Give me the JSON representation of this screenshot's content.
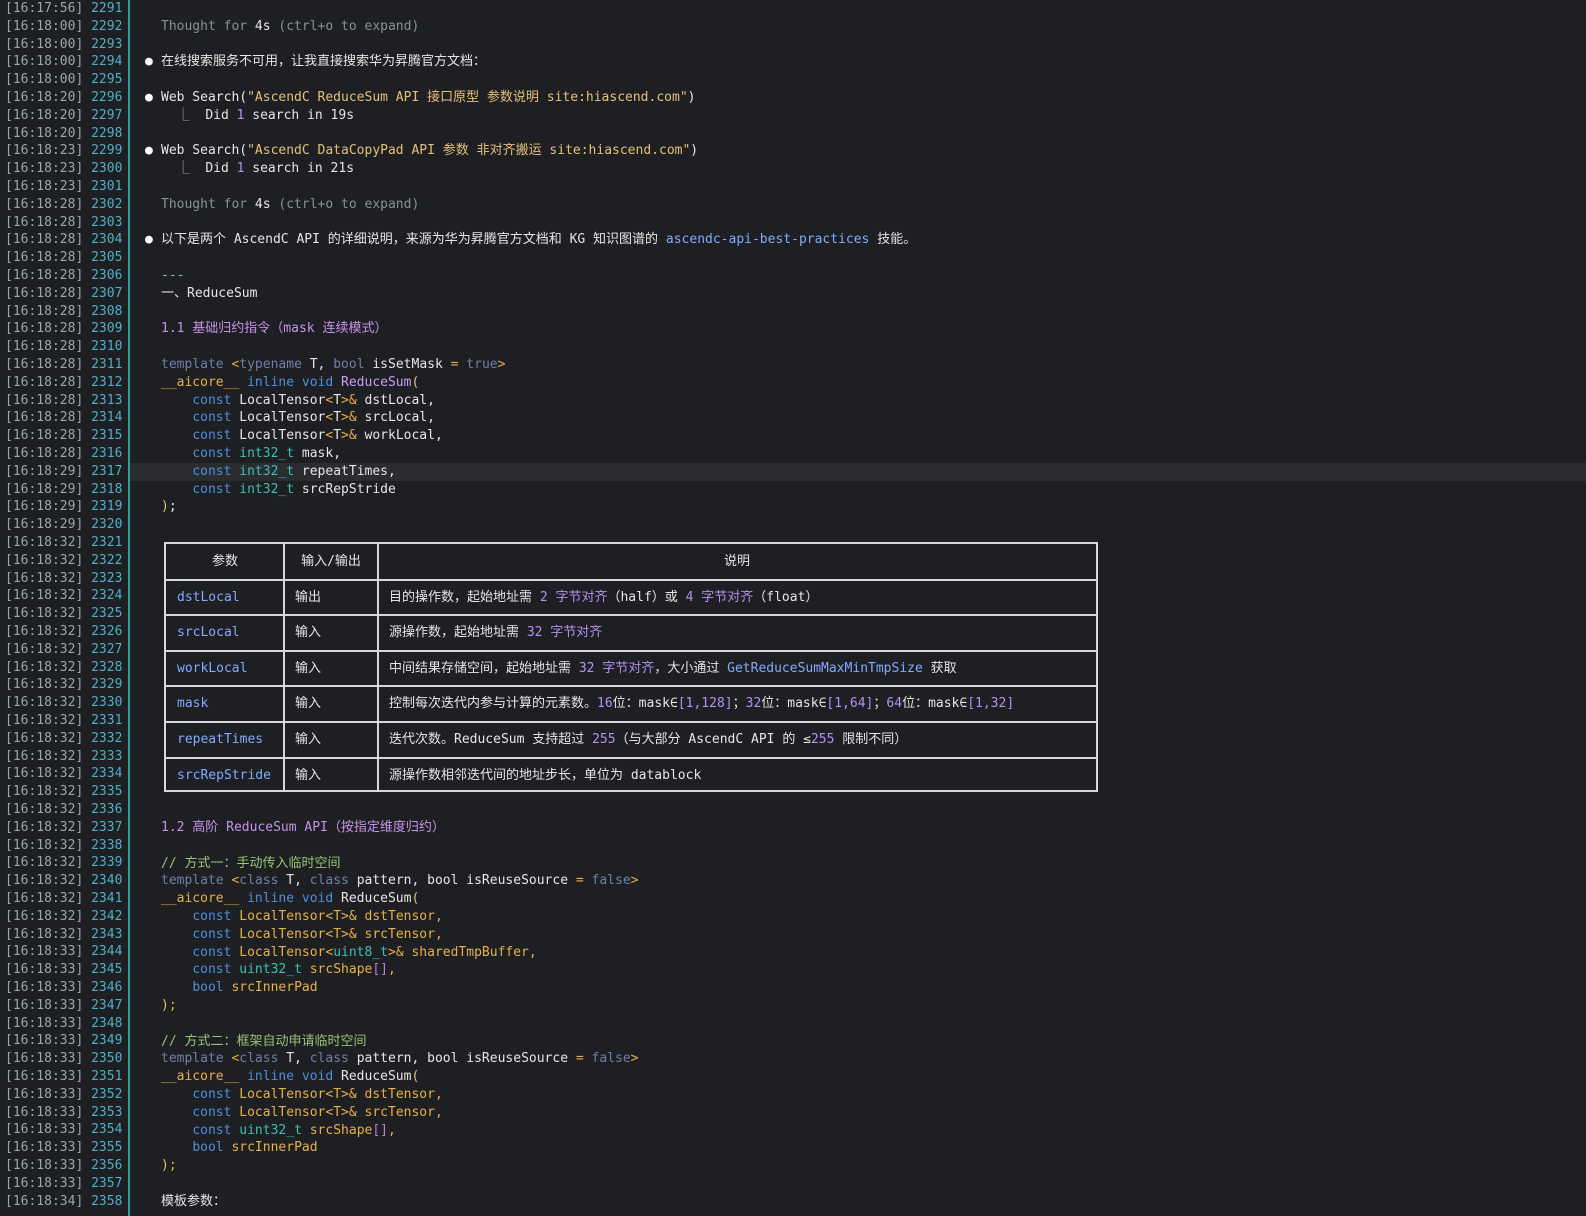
{
  "gutter": [
    {
      "ts": "[16:17:56]",
      "n": "2291"
    },
    {
      "ts": "[16:18:00]",
      "n": "2292"
    },
    {
      "ts": "[16:18:00]",
      "n": "2293"
    },
    {
      "ts": "[16:18:00]",
      "n": "2294"
    },
    {
      "ts": "[16:18:00]",
      "n": "2295"
    },
    {
      "ts": "[16:18:20]",
      "n": "2296"
    },
    {
      "ts": "[16:18:20]",
      "n": "2297"
    },
    {
      "ts": "[16:18:20]",
      "n": "2298"
    },
    {
      "ts": "[16:18:23]",
      "n": "2299"
    },
    {
      "ts": "[16:18:23]",
      "n": "2300"
    },
    {
      "ts": "[16:18:23]",
      "n": "2301"
    },
    {
      "ts": "[16:18:28]",
      "n": "2302"
    },
    {
      "ts": "[16:18:28]",
      "n": "2303"
    },
    {
      "ts": "[16:18:28]",
      "n": "2304"
    },
    {
      "ts": "[16:18:28]",
      "n": "2305"
    },
    {
      "ts": "[16:18:28]",
      "n": "2306"
    },
    {
      "ts": "[16:18:28]",
      "n": "2307"
    },
    {
      "ts": "[16:18:28]",
      "n": "2308"
    },
    {
      "ts": "[16:18:28]",
      "n": "2309"
    },
    {
      "ts": "[16:18:28]",
      "n": "2310"
    },
    {
      "ts": "[16:18:28]",
      "n": "2311"
    },
    {
      "ts": "[16:18:28]",
      "n": "2312"
    },
    {
      "ts": "[16:18:28]",
      "n": "2313"
    },
    {
      "ts": "[16:18:28]",
      "n": "2314"
    },
    {
      "ts": "[16:18:28]",
      "n": "2315"
    },
    {
      "ts": "[16:18:28]",
      "n": "2316"
    },
    {
      "ts": "[16:18:29]",
      "n": "2317"
    },
    {
      "ts": "[16:18:29]",
      "n": "2318"
    },
    {
      "ts": "[16:18:29]",
      "n": "2319"
    },
    {
      "ts": "[16:18:29]",
      "n": "2320"
    },
    {
      "ts": "[16:18:32]",
      "n": "2321"
    },
    {
      "ts": "[16:18:32]",
      "n": "2322"
    },
    {
      "ts": "[16:18:32]",
      "n": "2323"
    },
    {
      "ts": "[16:18:32]",
      "n": "2324"
    },
    {
      "ts": "[16:18:32]",
      "n": "2325"
    },
    {
      "ts": "[16:18:32]",
      "n": "2326"
    },
    {
      "ts": "[16:18:32]",
      "n": "2327"
    },
    {
      "ts": "[16:18:32]",
      "n": "2328"
    },
    {
      "ts": "[16:18:32]",
      "n": "2329"
    },
    {
      "ts": "[16:18:32]",
      "n": "2330"
    },
    {
      "ts": "[16:18:32]",
      "n": "2331"
    },
    {
      "ts": "[16:18:32]",
      "n": "2332"
    },
    {
      "ts": "[16:18:32]",
      "n": "2333"
    },
    {
      "ts": "[16:18:32]",
      "n": "2334"
    },
    {
      "ts": "[16:18:32]",
      "n": "2335"
    },
    {
      "ts": "[16:18:32]",
      "n": "2336"
    },
    {
      "ts": "[16:18:32]",
      "n": "2337"
    },
    {
      "ts": "[16:18:32]",
      "n": "2338"
    },
    {
      "ts": "[16:18:32]",
      "n": "2339"
    },
    {
      "ts": "[16:18:32]",
      "n": "2340"
    },
    {
      "ts": "[16:18:32]",
      "n": "2341"
    },
    {
      "ts": "[16:18:32]",
      "n": "2342"
    },
    {
      "ts": "[16:18:32]",
      "n": "2343"
    },
    {
      "ts": "[16:18:33]",
      "n": "2344"
    },
    {
      "ts": "[16:18:33]",
      "n": "2345"
    },
    {
      "ts": "[16:18:33]",
      "n": "2346"
    },
    {
      "ts": "[16:18:33]",
      "n": "2347"
    },
    {
      "ts": "[16:18:33]",
      "n": "2348"
    },
    {
      "ts": "[16:18:33]",
      "n": "2349"
    },
    {
      "ts": "[16:18:33]",
      "n": "2350"
    },
    {
      "ts": "[16:18:33]",
      "n": "2351"
    },
    {
      "ts": "[16:18:33]",
      "n": "2352"
    },
    {
      "ts": "[16:18:33]",
      "n": "2353"
    },
    {
      "ts": "[16:18:33]",
      "n": "2354"
    },
    {
      "ts": "[16:18:33]",
      "n": "2355"
    },
    {
      "ts": "[16:18:33]",
      "n": "2356"
    },
    {
      "ts": "[16:18:33]",
      "n": "2357"
    },
    {
      "ts": "[16:18:34]",
      "n": "2358"
    }
  ],
  "lines": [
    {
      "idx": 1,
      "parts": [
        [
          "dim",
          "Thought for "
        ],
        [
          "white",
          "4s"
        ],
        [
          "dim",
          " ("
        ],
        [
          "dim",
          "ctrl+o to expand"
        ],
        [
          "dim",
          ")"
        ]
      ]
    },
    {
      "idx": 3,
      "bullet": "●",
      "parts": [
        [
          "white",
          "在线搜索服务不可用，让我直接搜索华为昇腾官方文档："
        ]
      ]
    },
    {
      "idx": 5,
      "bullet": "●",
      "parts": [
        [
          "white",
          "Web Search("
        ],
        [
          "str",
          "\"AscendC ReduceSum API 接口原型 参数说明 site:hiascend.com\""
        ],
        [
          "white",
          ")"
        ]
      ]
    },
    {
      "idx": 6,
      "parts": [
        [
          "tree",
          "  ⎿  "
        ],
        [
          "white",
          "Did "
        ],
        [
          "num",
          "1"
        ],
        [
          "white",
          " search in 19s"
        ]
      ]
    },
    {
      "idx": 8,
      "bullet": "●",
      "parts": [
        [
          "white",
          "Web Search("
        ],
        [
          "str",
          "\"AscendC DataCopyPad API 参数 非对齐搬运 site:hiascend.com\""
        ],
        [
          "white",
          ")"
        ]
      ]
    },
    {
      "idx": 9,
      "parts": [
        [
          "tree",
          "  ⎿  "
        ],
        [
          "white",
          "Did "
        ],
        [
          "num",
          "1"
        ],
        [
          "white",
          " search in 21s"
        ]
      ]
    },
    {
      "idx": 11,
      "parts": [
        [
          "dim",
          "Thought for "
        ],
        [
          "white",
          "4s"
        ],
        [
          "dim",
          " ("
        ],
        [
          "dim",
          "ctrl+o to expand"
        ],
        [
          "dim",
          ")"
        ]
      ]
    },
    {
      "idx": 13,
      "bullet": "●",
      "parts": [
        [
          "white",
          "以下是两个 AscendC API 的详细说明，来源为华为昇腾官方文档和 KG 知识图谱的 "
        ],
        [
          "link",
          "ascendc-api-best-practices"
        ],
        [
          "white",
          " 技能。"
        ]
      ]
    },
    {
      "idx": 15,
      "parts": [
        [
          "cm",
          "---"
        ]
      ]
    },
    {
      "idx": 16,
      "parts": [
        [
          "white",
          "一、ReduceSum"
        ]
      ]
    },
    {
      "idx": 18,
      "parts": [
        [
          "pp",
          "1.1 基础归约指令（mask 连续模式）"
        ]
      ]
    },
    {
      "idx": 20,
      "parts": [
        [
          "kwd",
          "template "
        ],
        [
          "yw",
          "<"
        ],
        [
          "kwd",
          "typename "
        ],
        [
          "white",
          "T, "
        ],
        [
          "kwd",
          "bool "
        ],
        [
          "white",
          "isSetMask "
        ],
        [
          "yw",
          "= "
        ],
        [
          "kwd",
          "true"
        ],
        [
          "yw",
          ">"
        ]
      ]
    },
    {
      "idx": 21,
      "parts": [
        [
          "yw",
          "__aicore__ "
        ],
        [
          "kw",
          "inline void "
        ],
        [
          "fn",
          "ReduceSum"
        ],
        [
          "paren",
          "("
        ]
      ]
    },
    {
      "idx": 22,
      "parts": [
        [
          "white",
          "    "
        ],
        [
          "kw",
          "const "
        ],
        [
          "white",
          "LocalTensor"
        ],
        [
          "yw",
          "<"
        ],
        [
          "white",
          "T"
        ],
        [
          "yw",
          ">& "
        ],
        [
          "white",
          "dstLocal,"
        ]
      ]
    },
    {
      "idx": 23,
      "parts": [
        [
          "white",
          "    "
        ],
        [
          "kw",
          "const "
        ],
        [
          "white",
          "LocalTensor"
        ],
        [
          "yw",
          "<"
        ],
        [
          "white",
          "T"
        ],
        [
          "yw",
          ">& "
        ],
        [
          "white",
          "srcLocal,"
        ]
      ]
    },
    {
      "idx": 24,
      "parts": [
        [
          "white",
          "    "
        ],
        [
          "kw",
          "const "
        ],
        [
          "white",
          "LocalTensor"
        ],
        [
          "yw",
          "<"
        ],
        [
          "white",
          "T"
        ],
        [
          "yw",
          ">& "
        ],
        [
          "white",
          "workLocal,"
        ]
      ]
    },
    {
      "idx": 25,
      "parts": [
        [
          "white",
          "    "
        ],
        [
          "kw",
          "const "
        ],
        [
          "ty",
          "int32_t "
        ],
        [
          "white",
          "mask,"
        ]
      ]
    },
    {
      "idx": 26,
      "hl": true,
      "parts": [
        [
          "white",
          "    "
        ],
        [
          "kw",
          "const "
        ],
        [
          "ty",
          "int32_t "
        ],
        [
          "white",
          "repeatTimes,"
        ]
      ]
    },
    {
      "idx": 27,
      "parts": [
        [
          "white",
          "    "
        ],
        [
          "kw",
          "const "
        ],
        [
          "ty",
          "int32_t "
        ],
        [
          "white",
          "srcRepStride"
        ]
      ]
    },
    {
      "idx": 28,
      "parts": [
        [
          "paren",
          ")"
        ],
        [
          "white",
          ";"
        ]
      ]
    },
    {
      "idx": 46,
      "parts": [
        [
          "pp",
          "1.2 高阶 ReduceSum API（按指定维度归约）"
        ]
      ]
    },
    {
      "idx": 48,
      "parts": [
        [
          "cm",
          "// 方式一：手动传入临时空间"
        ]
      ]
    },
    {
      "idx": 49,
      "parts": [
        [
          "kwd",
          "template "
        ],
        [
          "yw",
          "<"
        ],
        [
          "kwd",
          "class "
        ],
        [
          "white",
          "T, "
        ],
        [
          "kwd",
          "class "
        ],
        [
          "white",
          "pattern, bool isReuseSource "
        ],
        [
          "yw",
          "= "
        ],
        [
          "kwd",
          "false"
        ],
        [
          "yw",
          ">"
        ]
      ]
    },
    {
      "idx": 50,
      "parts": [
        [
          "yw",
          "__aicore__ "
        ],
        [
          "kw",
          "inline void "
        ],
        [
          "white",
          "ReduceSum"
        ],
        [
          "paren",
          "("
        ]
      ]
    },
    {
      "idx": 51,
      "parts": [
        [
          "white",
          "    "
        ],
        [
          "kw",
          "const "
        ],
        [
          "yw",
          "LocalTensor<T>& dstTensor,"
        ]
      ]
    },
    {
      "idx": 52,
      "parts": [
        [
          "white",
          "    "
        ],
        [
          "kw",
          "const "
        ],
        [
          "yw",
          "LocalTensor<T>& srcTensor,"
        ]
      ]
    },
    {
      "idx": 53,
      "parts": [
        [
          "white",
          "    "
        ],
        [
          "kw",
          "const "
        ],
        [
          "yw",
          "LocalTensor<"
        ],
        [
          "ty",
          "uint8_t"
        ],
        [
          "yw",
          ">& sharedTmpBuffer,"
        ]
      ]
    },
    {
      "idx": 54,
      "parts": [
        [
          "white",
          "    "
        ],
        [
          "kw",
          "const "
        ],
        [
          "ty",
          "uint32_t "
        ],
        [
          "yw",
          "srcShape"
        ],
        [
          "brk",
          "[]"
        ],
        [
          "yw",
          ","
        ]
      ]
    },
    {
      "idx": 55,
      "parts": [
        [
          "white",
          "    "
        ],
        [
          "kw",
          "bool "
        ],
        [
          "yw",
          "srcInnerPad"
        ]
      ]
    },
    {
      "idx": 56,
      "parts": [
        [
          "paren",
          ")"
        ],
        [
          "yw",
          ";"
        ]
      ]
    },
    {
      "idx": 58,
      "parts": [
        [
          "cm",
          "// 方式二：框架自动申请临时空间"
        ]
      ]
    },
    {
      "idx": 59,
      "parts": [
        [
          "kwd",
          "template "
        ],
        [
          "yw",
          "<"
        ],
        [
          "kwd",
          "class "
        ],
        [
          "white",
          "T, "
        ],
        [
          "kwd",
          "class "
        ],
        [
          "white",
          "pattern, bool isReuseSource "
        ],
        [
          "yw",
          "= "
        ],
        [
          "kwd",
          "false"
        ],
        [
          "yw",
          ">"
        ]
      ]
    },
    {
      "idx": 60,
      "parts": [
        [
          "yw",
          "__aicore__ "
        ],
        [
          "kw",
          "inline void "
        ],
        [
          "white",
          "ReduceSum"
        ],
        [
          "paren",
          "("
        ]
      ]
    },
    {
      "idx": 61,
      "parts": [
        [
          "white",
          "    "
        ],
        [
          "kw",
          "const "
        ],
        [
          "yw",
          "LocalTensor<T>& dstTensor,"
        ]
      ]
    },
    {
      "idx": 62,
      "parts": [
        [
          "white",
          "    "
        ],
        [
          "kw",
          "const "
        ],
        [
          "yw",
          "LocalTensor<T>& srcTensor,"
        ]
      ]
    },
    {
      "idx": 63,
      "parts": [
        [
          "white",
          "    "
        ],
        [
          "kw",
          "const "
        ],
        [
          "ty",
          "uint32_t "
        ],
        [
          "yw",
          "srcShape"
        ],
        [
          "brk",
          "[]"
        ],
        [
          "yw",
          ","
        ]
      ]
    },
    {
      "idx": 64,
      "parts": [
        [
          "white",
          "    "
        ],
        [
          "kw",
          "bool "
        ],
        [
          "yw",
          "srcInnerPad"
        ]
      ]
    },
    {
      "idx": 65,
      "parts": [
        [
          "paren",
          ")"
        ],
        [
          "yw",
          ";"
        ]
      ]
    },
    {
      "idx": 67,
      "parts": [
        [
          "white",
          "模板参数："
        ]
      ]
    }
  ],
  "table": {
    "headers": [
      "参数",
      "输入/输出",
      "说明"
    ],
    "rows": [
      {
        "param": "dstLocal",
        "io": "输出",
        "desc": [
          [
            "white",
            "目的操作数，起始地址需 "
          ],
          [
            "num",
            "2 字节对齐"
          ],
          [
            "white",
            "（half）或 "
          ],
          [
            "num",
            "4 字节对齐"
          ],
          [
            "white",
            "（float）"
          ]
        ]
      },
      {
        "param": "srcLocal",
        "io": "输入",
        "desc": [
          [
            "white",
            "源操作数，起始地址需 "
          ],
          [
            "num",
            "32 字节对齐"
          ]
        ]
      },
      {
        "param": "workLocal",
        "io": "输入",
        "desc": [
          [
            "white",
            "中间结果存储空间，起始地址需 "
          ],
          [
            "num",
            "32 字节对齐"
          ],
          [
            "white",
            "，大小通过 "
          ],
          [
            "link",
            "GetReduceSumMaxMinTmpSize"
          ],
          [
            "white",
            " 获取"
          ]
        ]
      },
      {
        "param": "mask",
        "io": "输入",
        "desc": [
          [
            "white",
            "控制每次迭代内参与计算的元素数。"
          ],
          [
            "num",
            "16"
          ],
          [
            "white",
            "位：mask∈"
          ],
          [
            "num",
            "[1,128]"
          ],
          [
            "white",
            "；"
          ],
          [
            "num",
            "32"
          ],
          [
            "white",
            "位：mask∈"
          ],
          [
            "num",
            "[1,64]"
          ],
          [
            "white",
            "；"
          ],
          [
            "num",
            "64"
          ],
          [
            "white",
            "位：mask∈"
          ],
          [
            "num",
            "[1,32]"
          ]
        ]
      },
      {
        "param": "repeatTimes",
        "io": "输入",
        "desc": [
          [
            "white",
            "迭代次数。ReduceSum 支持超过 "
          ],
          [
            "num",
            "255"
          ],
          [
            "white",
            "（与大部分 AscendC API 的 ≤"
          ],
          [
            "num",
            "255"
          ],
          [
            "white",
            " 限制不同）"
          ]
        ]
      },
      {
        "param": "srcRepStride",
        "io": "输入",
        "desc": [
          [
            "white",
            "源操作数相邻迭代间的地址步长，单位为 datablock"
          ]
        ]
      }
    ]
  }
}
